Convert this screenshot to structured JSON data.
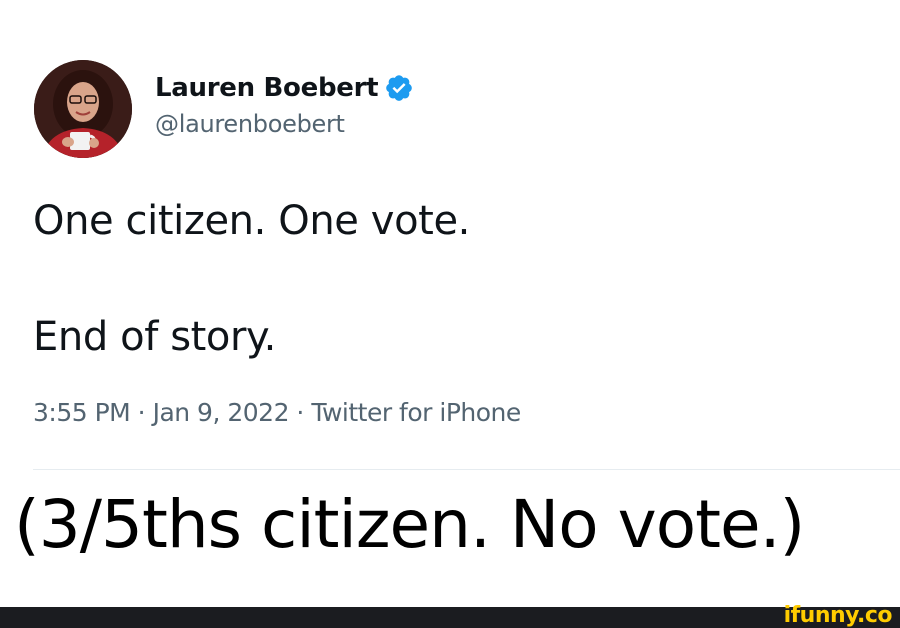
{
  "tweet": {
    "author_name": "Lauren Boebert",
    "handle": "@laurenboebert",
    "text_line_1": "One citizen. One vote.",
    "text_line_2": "End of story.",
    "metadata": "3:55 PM · Jan 9, 2022 · Twitter for iPhone",
    "verified_icon": "verified-badge-icon",
    "verified_color": "#1d9bf0"
  },
  "caption": "(3/5ths citizen. No vote.)",
  "watermark": {
    "text": "ifunny.co",
    "color": "#ffcc00"
  },
  "colors": {
    "primary_text": "#0f1419",
    "secondary_text": "#536471",
    "footer_bar": "#1b1c20"
  }
}
